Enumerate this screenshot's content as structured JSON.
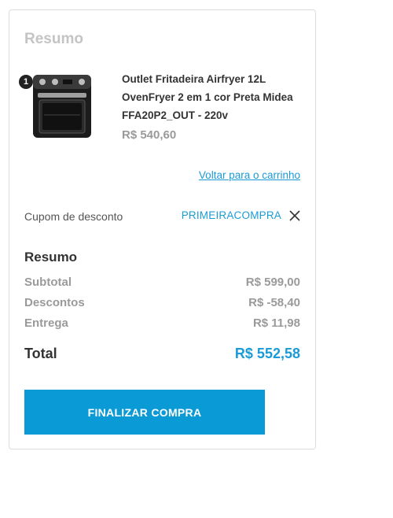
{
  "summary": {
    "title": "Resumo",
    "product": {
      "quantity": "1",
      "name": "Outlet Fritadeira Airfryer 12L OvenFryer 2 em 1 cor Preta Midea FFA20P2_OUT - 220v",
      "price": "R$ 540,60"
    },
    "back_link": "Voltar para o carrinho",
    "coupon": {
      "label": "Cupom de desconto",
      "code": "PRIMEIRACOMPRA"
    },
    "totals_title": "Resumo",
    "lines": [
      {
        "label": "Subtotal",
        "value": "R$ 599,00"
      },
      {
        "label": "Descontos",
        "value": "R$ -58,40"
      },
      {
        "label": "Entrega",
        "value": "R$ 11,98"
      }
    ],
    "total": {
      "label": "Total",
      "value": "R$ 552,58"
    },
    "checkout_label": "FINALIZAR COMPRA"
  },
  "colors": {
    "accent": "#0a9ad6",
    "link": "#1a9bd7",
    "muted": "#9a9a9a"
  },
  "icons": {
    "product": "airfryer-oven-image",
    "remove_coupon": "close-icon"
  }
}
